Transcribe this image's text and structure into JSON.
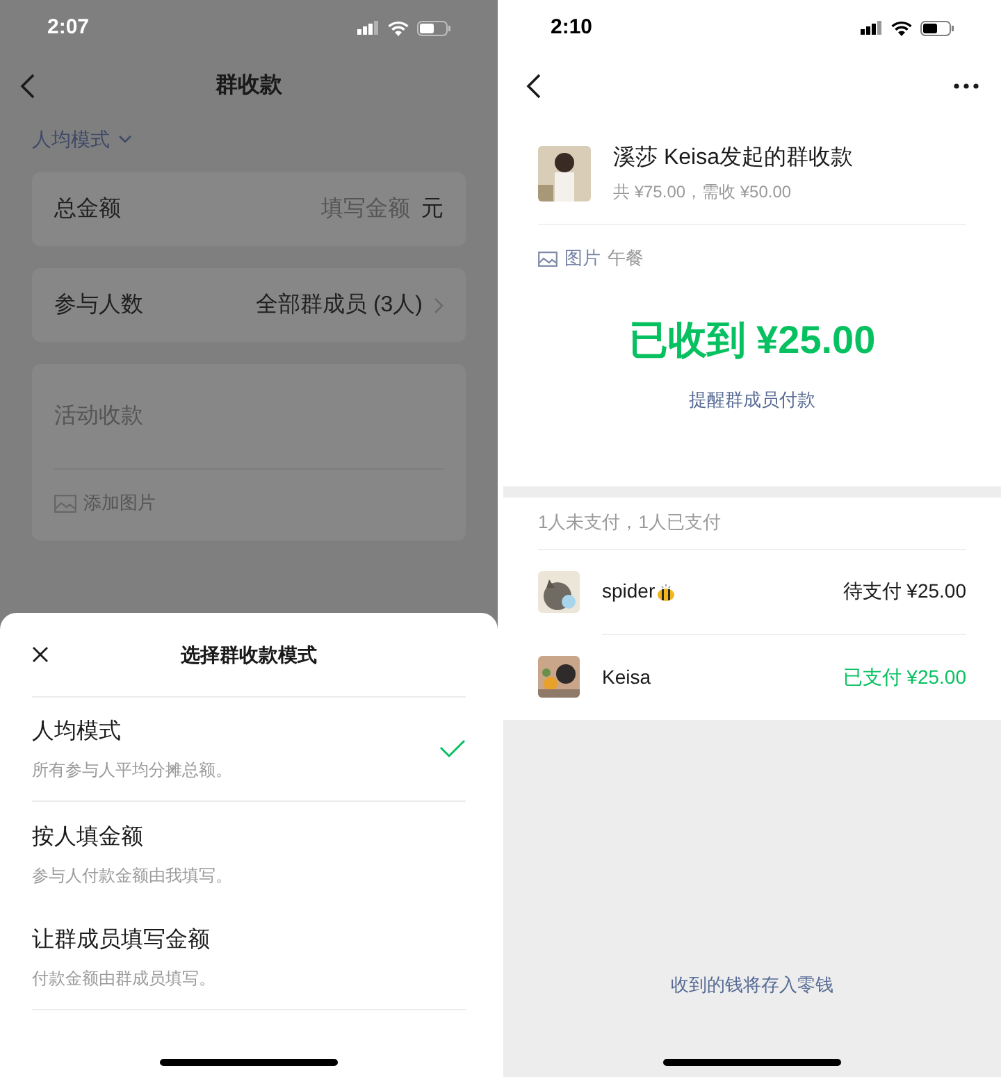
{
  "left_screen": {
    "status_time": "2:07",
    "nav_title": "群收款",
    "mode_selector": "人均模式",
    "total_field": {
      "label": "总金额",
      "placeholder": "填写金额",
      "unit": "元"
    },
    "participants_field": {
      "label": "参与人数",
      "value": "全部群成员 (3人)"
    },
    "description_field": {
      "placeholder": "活动收款",
      "add_image": "添加图片"
    },
    "sheet": {
      "title": "选择群收款模式",
      "options": [
        {
          "title": "人均模式",
          "description": "所有参与人平均分摊总额。",
          "selected": true
        },
        {
          "title": "按人填金额",
          "description": "参与人付款金额由我填写。",
          "selected": false
        },
        {
          "title": "让群成员填写金额",
          "description": "付款金额由群成员填写。",
          "selected": false
        }
      ]
    }
  },
  "right_screen": {
    "status_time": "2:10",
    "header": {
      "title": "溪莎 Keisa发起的群收款",
      "subtitle": "共 ¥75.00，需收 ¥50.00"
    },
    "note": {
      "label": "图片",
      "text": "午餐"
    },
    "received": "已收到 ¥25.00",
    "remind_link": "提醒群成员付款",
    "summary": "1人未支付，1人已支付",
    "members": [
      {
        "name": "spider",
        "status": "待支付 ¥25.00",
        "paid": false
      },
      {
        "name": "Keisa",
        "status": "已支付 ¥25.00",
        "paid": true
      }
    ],
    "footer": "收到的钱将存入零钱"
  }
}
